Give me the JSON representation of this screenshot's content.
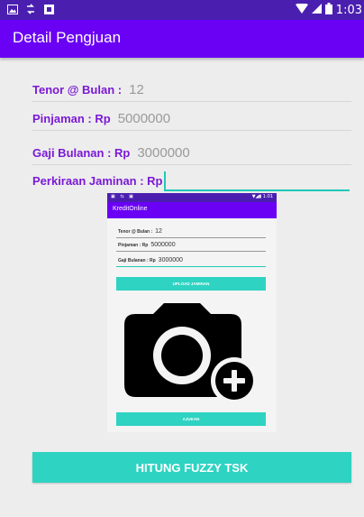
{
  "status_bar": {
    "time": "1:03"
  },
  "app_bar": {
    "title": "Detail Pengjuan"
  },
  "form": {
    "tenor_label": "Tenor @ Bulan :",
    "tenor_value": "12",
    "pinjaman_label": "Pinjaman : Rp",
    "pinjaman_value": "5000000",
    "gaji_label": "Gaji Bulanan : Rp",
    "gaji_value": "3000000",
    "jaminan_label": "Perkiraan Jaminan : Rp",
    "jaminan_value": ""
  },
  "embedded_screenshot": {
    "time": "1:01",
    "title": "KreditOnline",
    "tenor_label": "Tenor @ Bulan :",
    "tenor_value": "12",
    "pinjaman_label": "Pinjaman : Rp",
    "pinjaman_value": "5000000",
    "gaji_label": "Gaji Bulanan : Rp",
    "gaji_value": "3000000",
    "upload_button": "UPLOAD JAMINAN",
    "ajukan_button": "AJUKAN",
    "image_icon": "add-photo-camera-icon"
  },
  "main_button": {
    "label": "HITUNG FUZZY TSK"
  },
  "colors": {
    "status_bar": "#4a1fb0",
    "app_bar": "#6a00f4",
    "label": "#7a19d6",
    "accent": "#2ed3c2"
  }
}
